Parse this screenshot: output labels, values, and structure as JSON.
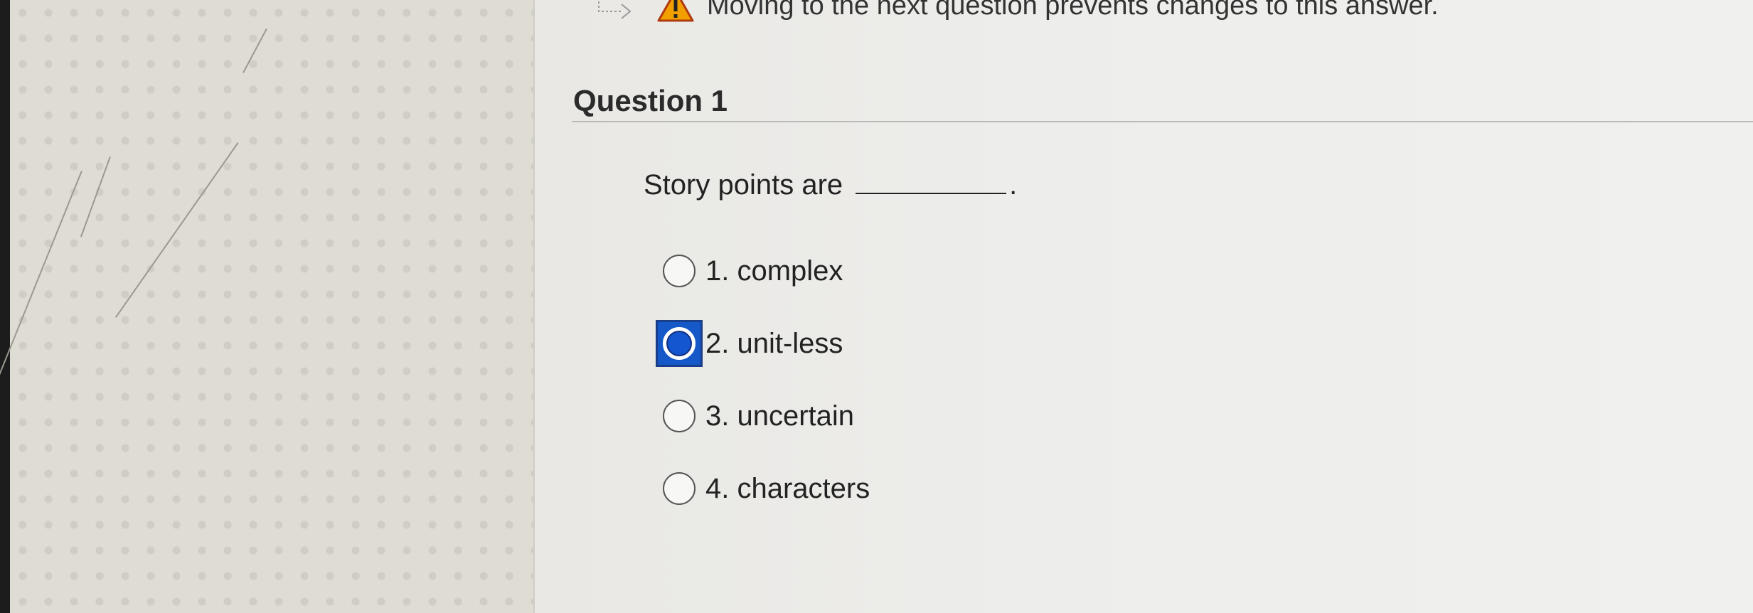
{
  "warning": {
    "text": "Moving to the next question prevents changes to this answer.",
    "icon": "warning-triangle-icon",
    "arrow_icon": "next-arrow-icon"
  },
  "question": {
    "title": "Question 1",
    "stem_text": "Story points are",
    "stem_end": "."
  },
  "choices": [
    {
      "label": "1. complex",
      "selected": false
    },
    {
      "label": "2. unit-less",
      "selected": true
    },
    {
      "label": "3. uncertain",
      "selected": false
    },
    {
      "label": "4. characters",
      "selected": false
    }
  ],
  "colors": {
    "selected_accent": "#1455d0",
    "warning_fill": "#f2a000"
  }
}
